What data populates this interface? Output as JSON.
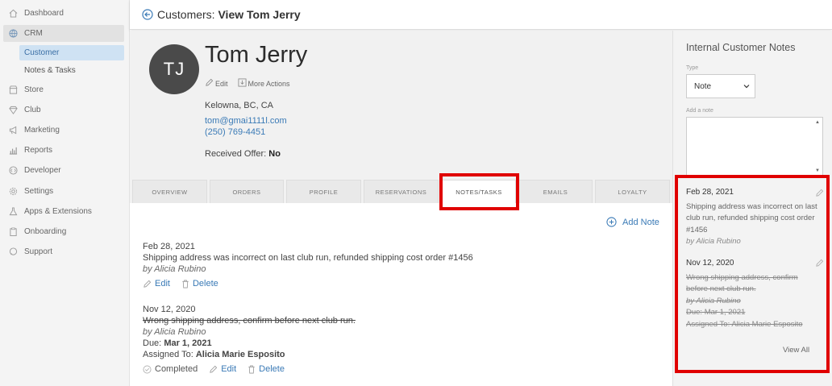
{
  "sidebar": {
    "items": [
      {
        "label": "Dashboard",
        "icon": "home-icon"
      },
      {
        "label": "CRM",
        "icon": "globe-icon"
      },
      {
        "label": "Store",
        "icon": "store-icon"
      },
      {
        "label": "Club",
        "icon": "diamond-icon"
      },
      {
        "label": "Marketing",
        "icon": "megaphone-icon"
      },
      {
        "label": "Reports",
        "icon": "bar-chart-icon"
      },
      {
        "label": "Developer",
        "icon": "code-icon"
      },
      {
        "label": "Settings",
        "icon": "gear-icon"
      },
      {
        "label": "Apps & Extensions",
        "icon": "flask-icon"
      },
      {
        "label": "Onboarding",
        "icon": "clipboard-icon"
      },
      {
        "label": "Support",
        "icon": "chat-icon"
      }
    ],
    "subitems": [
      {
        "label": "Customer"
      },
      {
        "label": "Notes & Tasks"
      }
    ]
  },
  "header": {
    "prefix": "Customers:",
    "title": "View Tom Jerry"
  },
  "profile": {
    "initials": "TJ",
    "name": "Tom Jerry",
    "edit_label": "Edit",
    "more_actions_label": "More Actions",
    "location": "Kelowna, BC, CA",
    "email": "tom@gmai1111l.com",
    "phone": "(250) 769-4451",
    "offer_label": "Received Offer:",
    "offer_value": "No"
  },
  "tabs": [
    {
      "label": "OVERVIEW"
    },
    {
      "label": "ORDERS"
    },
    {
      "label": "PROFILE"
    },
    {
      "label": "RESERVATIONS"
    },
    {
      "label": "NOTES/TASKS"
    },
    {
      "label": "EMAILS"
    },
    {
      "label": "LOYALTY"
    }
  ],
  "notes": {
    "add_label": "Add Note",
    "items": [
      {
        "date": "Feb 28, 2021",
        "text": "Shipping address was incorrect on last club run, refunded shipping cost order #1456",
        "author": "by Alicia Rubino",
        "edit_label": "Edit",
        "delete_label": "Delete"
      },
      {
        "date": "Nov 12, 2020",
        "text": "Wrong shipping address, confirm before next club run.",
        "author": "by Alicia Rubino",
        "due_label": "Due:",
        "due_value": "Mar 1, 2021",
        "assigned_label": "Assigned To:",
        "assigned_value": "Alicia Marie Esposito",
        "completed_label": "Completed",
        "edit_label": "Edit",
        "delete_label": "Delete"
      }
    ]
  },
  "panel": {
    "title": "Internal Customer Notes",
    "type_label": "Type",
    "type_value": "Note",
    "note_label": "Add a note",
    "notes": [
      {
        "date": "Feb 28, 2021",
        "text_lines": [
          "Shipping address was incorrect on last",
          "club run, refunded shipping cost order",
          "#1456"
        ],
        "author": "by Alicia Rubino"
      },
      {
        "date": "Nov 12, 2020",
        "text_lines": [
          "Wrong shipping address, confirm",
          "before next club run."
        ],
        "author": "by Alicia Rubino",
        "due": "Due: Mar 1, 2021",
        "assigned": "Assigned To: Alicia Marie Esposito"
      }
    ],
    "view_all_label": "View All"
  },
  "colors": {
    "highlight": "#e00000",
    "link": "#3a7ab6",
    "active_nav": "#cfe2f3"
  }
}
